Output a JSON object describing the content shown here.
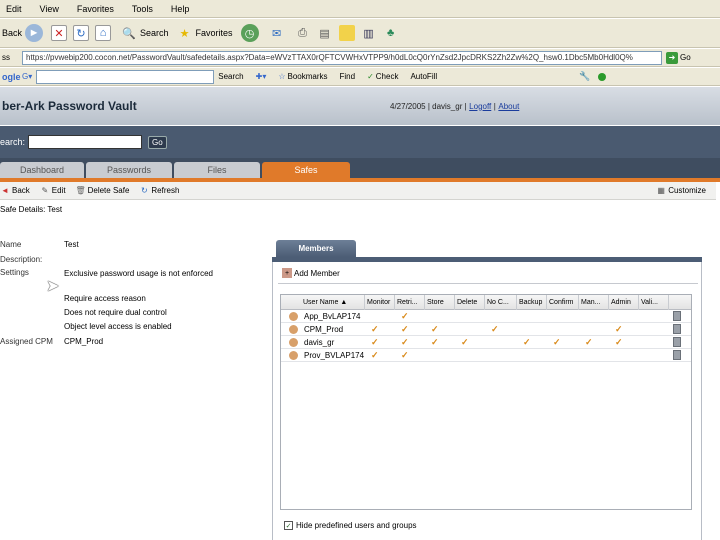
{
  "menu": [
    "Edit",
    "View",
    "Favorites",
    "Tools",
    "Help"
  ],
  "toolbar": {
    "back": "Back",
    "search": "Search",
    "favorites": "Favorites"
  },
  "address": {
    "label": "ss",
    "url": "https://pvwebip200.cocon.net/PasswordVault/safedetails.aspx?Data=eWVzTTAX0rQFTCVWHxVTPP9/h0dL0cQ0rYnZsd2JpcDRKS2Zh2Zw%2Q_hsw0.1Dbc5Mb0Hdl0Q%",
    "go": "Go"
  },
  "google_bar": {
    "logo": "ogle",
    "search_label": "Search",
    "bookmarks": "Bookmarks",
    "find": "Find",
    "check": "Check",
    "autofill": "AutoFill"
  },
  "app": {
    "logo": "ber-Ark Password Vault",
    "user_info": "4/27/2005 | davis_gr |",
    "logoff": "Logoff",
    "about": "About"
  },
  "search": {
    "label": "earch:",
    "go": "Go"
  },
  "tabs": [
    "Dashboard",
    "Passwords",
    "Files",
    "Safes"
  ],
  "actions": {
    "back": "Back",
    "edit": "Edit",
    "delete_safe": "Delete Safe",
    "refresh": "Refresh",
    "customize": "Customize"
  },
  "safe": {
    "title": "Safe Details: Test",
    "name_label": "Name",
    "name": "Test",
    "description_label": "Description:",
    "settings_label": "Settings",
    "settings": [
      "Exclusive password usage is not enforced",
      "Require access reason",
      "Does not require dual control",
      "Object level access is enabled"
    ],
    "cpm_label": "Assigned CPM",
    "cpm": "CPM_Prod"
  },
  "members": {
    "tab": "Members",
    "add_member": "Add Member",
    "columns": [
      "User Name",
      "Monitor",
      "Retri...",
      "Store",
      "Delete",
      "No C...",
      "Backup",
      "Confirm",
      "Man...",
      "Admin",
      "Vali..."
    ],
    "rows": [
      {
        "name": "App_BvLAP174",
        "checks": [
          false,
          true,
          false,
          false,
          false,
          false,
          false,
          false,
          false,
          false
        ]
      },
      {
        "name": "CPM_Prod",
        "checks": [
          true,
          true,
          true,
          false,
          true,
          false,
          false,
          false,
          true,
          false
        ]
      },
      {
        "name": "davis_gr",
        "checks": [
          true,
          true,
          true,
          true,
          false,
          true,
          true,
          true,
          true,
          false
        ]
      },
      {
        "name": "Prov_BVLAP174",
        "checks": [
          true,
          true,
          false,
          false,
          false,
          false,
          false,
          false,
          false,
          false
        ]
      }
    ],
    "hide_label": "Hide predefined users and groups"
  }
}
